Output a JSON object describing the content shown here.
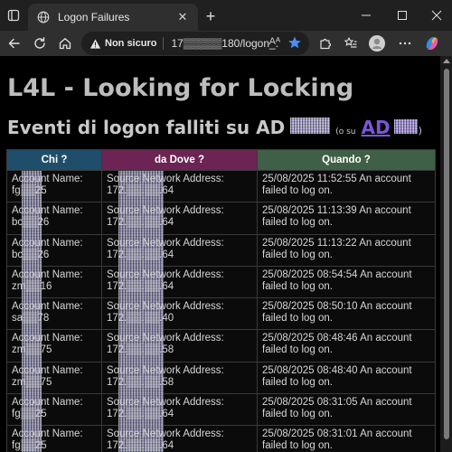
{
  "browser": {
    "tab_title": "Logon Failures",
    "new_tab_symbol": "+",
    "close_tab_symbol": "✕",
    "security_label": "Non sicuro",
    "url": "17▒▒▒▒▒180/logon_...",
    "reader_label": "Aᴬ"
  },
  "page": {
    "heading": "L4L - Looking for Locking",
    "subtitle_prefix": "Eventi di logon falliti su AD",
    "subtitle_or": "(o su",
    "subtitle_link": "AD",
    "subtitle_close": ")"
  },
  "table": {
    "headers": [
      "Chi ?",
      "da Dove ?",
      "Quando ?"
    ],
    "rows": [
      {
        "who_label": "Account Name:",
        "who_value": "fg▒▒25",
        "where_label": "Source Network Address:",
        "where_value": "172.▒▒.▒▒.64",
        "when": "25/08/2025 11:52:55 An account failed to log on."
      },
      {
        "who_label": "Account Name:",
        "who_value": "bc▒▒26",
        "where_label": "Source Network Address:",
        "where_value": "172.▒▒.▒▒.64",
        "when": "25/08/2025 11:13:39 An account failed to log on."
      },
      {
        "who_label": "Account Name:",
        "who_value": "bc▒▒26",
        "where_label": "Source Network Address:",
        "where_value": "172.▒▒.▒▒.64",
        "when": "25/08/2025 11:13:22 An account failed to log on."
      },
      {
        "who_label": "Account Name:",
        "who_value": "zm▒▒16",
        "where_label": "Source Network Address:",
        "where_value": "172.▒▒.▒▒.64",
        "when": "25/08/2025 08:54:54 An account failed to log on."
      },
      {
        "who_label": "Account Name:",
        "who_value": "sa▒▒78",
        "where_label": "Source Network Address:",
        "where_value": "172.▒▒.▒▒.40",
        "when": "25/08/2025 08:50:10 An account failed to log on."
      },
      {
        "who_label": "Account Name:",
        "who_value": "zm▒▒75",
        "where_label": "Source Network Address:",
        "where_value": "172.▒▒.▒▒.58",
        "when": "25/08/2025 08:48:46 An account failed to log on."
      },
      {
        "who_label": "Account Name:",
        "who_value": "zm▒▒75",
        "where_label": "Source Network Address:",
        "where_value": "172.▒▒.▒▒.58",
        "when": "25/08/2025 08:48:40 An account failed to log on."
      },
      {
        "who_label": "Account Name:",
        "who_value": "fg▒▒25",
        "where_label": "Source Network Address:",
        "where_value": "172.▒▒.▒▒.64",
        "when": "25/08/2025 08:31:05 An account failed to log on."
      },
      {
        "who_label": "Account Name:",
        "who_value": "fg▒▒25",
        "where_label": "Source Network Address:",
        "where_value": "172.▒▒.▒▒.64",
        "when": "25/08/2025 08:31:01 An account failed to log on."
      }
    ]
  },
  "colors": {
    "header_who": "#1f4e6b",
    "header_where": "#6b2453",
    "header_when": "#3f5f46",
    "link": "#7b56d6",
    "star": "#4c8df6"
  }
}
